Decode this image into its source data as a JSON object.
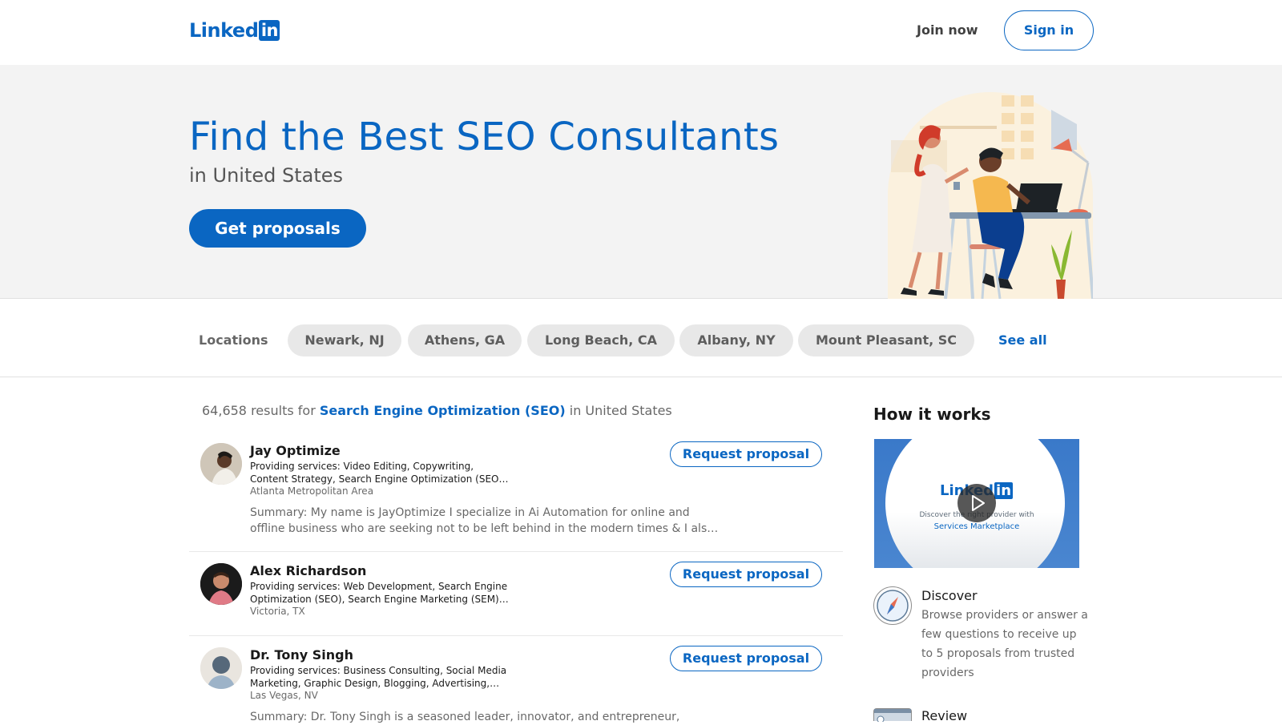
{
  "header": {
    "logo_text": "Linked",
    "logo_box_text": "in",
    "join_label": "Join now",
    "signin_label": "Sign in"
  },
  "hero": {
    "title": "Find the Best SEO Consultants",
    "subtitle": "in United States",
    "cta_label": "Get proposals"
  },
  "locations": {
    "label": "Locations",
    "items": [
      "Newark, NJ",
      "Athens, GA",
      "Long Beach, CA",
      "Albany, NY",
      "Mount Pleasant, SC"
    ],
    "see_all": "See all"
  },
  "results": {
    "count": "64,658",
    "prefix": "results for",
    "keyword": "Search Engine Optimization (SEO)",
    "suffix": "in United States",
    "cards": [
      {
        "name": "Jay Optimize",
        "services_line1": "Providing services: Video Editing, Copywriting,",
        "services_line2": "Content Strategy, Search Engine Optimization (SEO…",
        "location": "Atlanta Metropolitan Area",
        "summary_line1": "Summary: My name is JayOptimize I specialize in Ai Automation for online and",
        "summary_line2": "offline business who are seeking not to be left behind in the modern times & I als…",
        "button": "Request proposal"
      },
      {
        "name": "Alex Richardson",
        "services_line1": "Providing services: Web Development, Search Engine",
        "services_line2": "Optimization (SEO), Search Engine Marketing (SEM)…",
        "location": "Victoria, TX",
        "button": "Request proposal"
      },
      {
        "name": "Dr. Tony Singh",
        "services_line1": "Providing services: Business Consulting, Social Media",
        "services_line2": "Marketing, Graphic Design, Blogging, Advertising,…",
        "location": "Las Vegas, NV",
        "summary_line1": "Summary: Dr. Tony Singh is a seasoned leader, innovator, and entrepreneur,",
        "button": "Request proposal"
      }
    ]
  },
  "how_it_works": {
    "title": "How it works",
    "video_logo": "Linked",
    "video_logo_box": "in",
    "video_caption1": "Discover the right provider with",
    "video_caption2": "Services Marketplace",
    "steps": [
      {
        "title": "Discover",
        "desc": "Browse providers or answer a few questions to receive up to 5 proposals from trusted providers",
        "icon": "compass-icon"
      },
      {
        "title": "Review",
        "icon": "review-icon"
      }
    ]
  },
  "colors": {
    "brand": "#0a66c2",
    "hero_bg": "#f3f3f3",
    "pill_bg": "#e8e8e8"
  }
}
